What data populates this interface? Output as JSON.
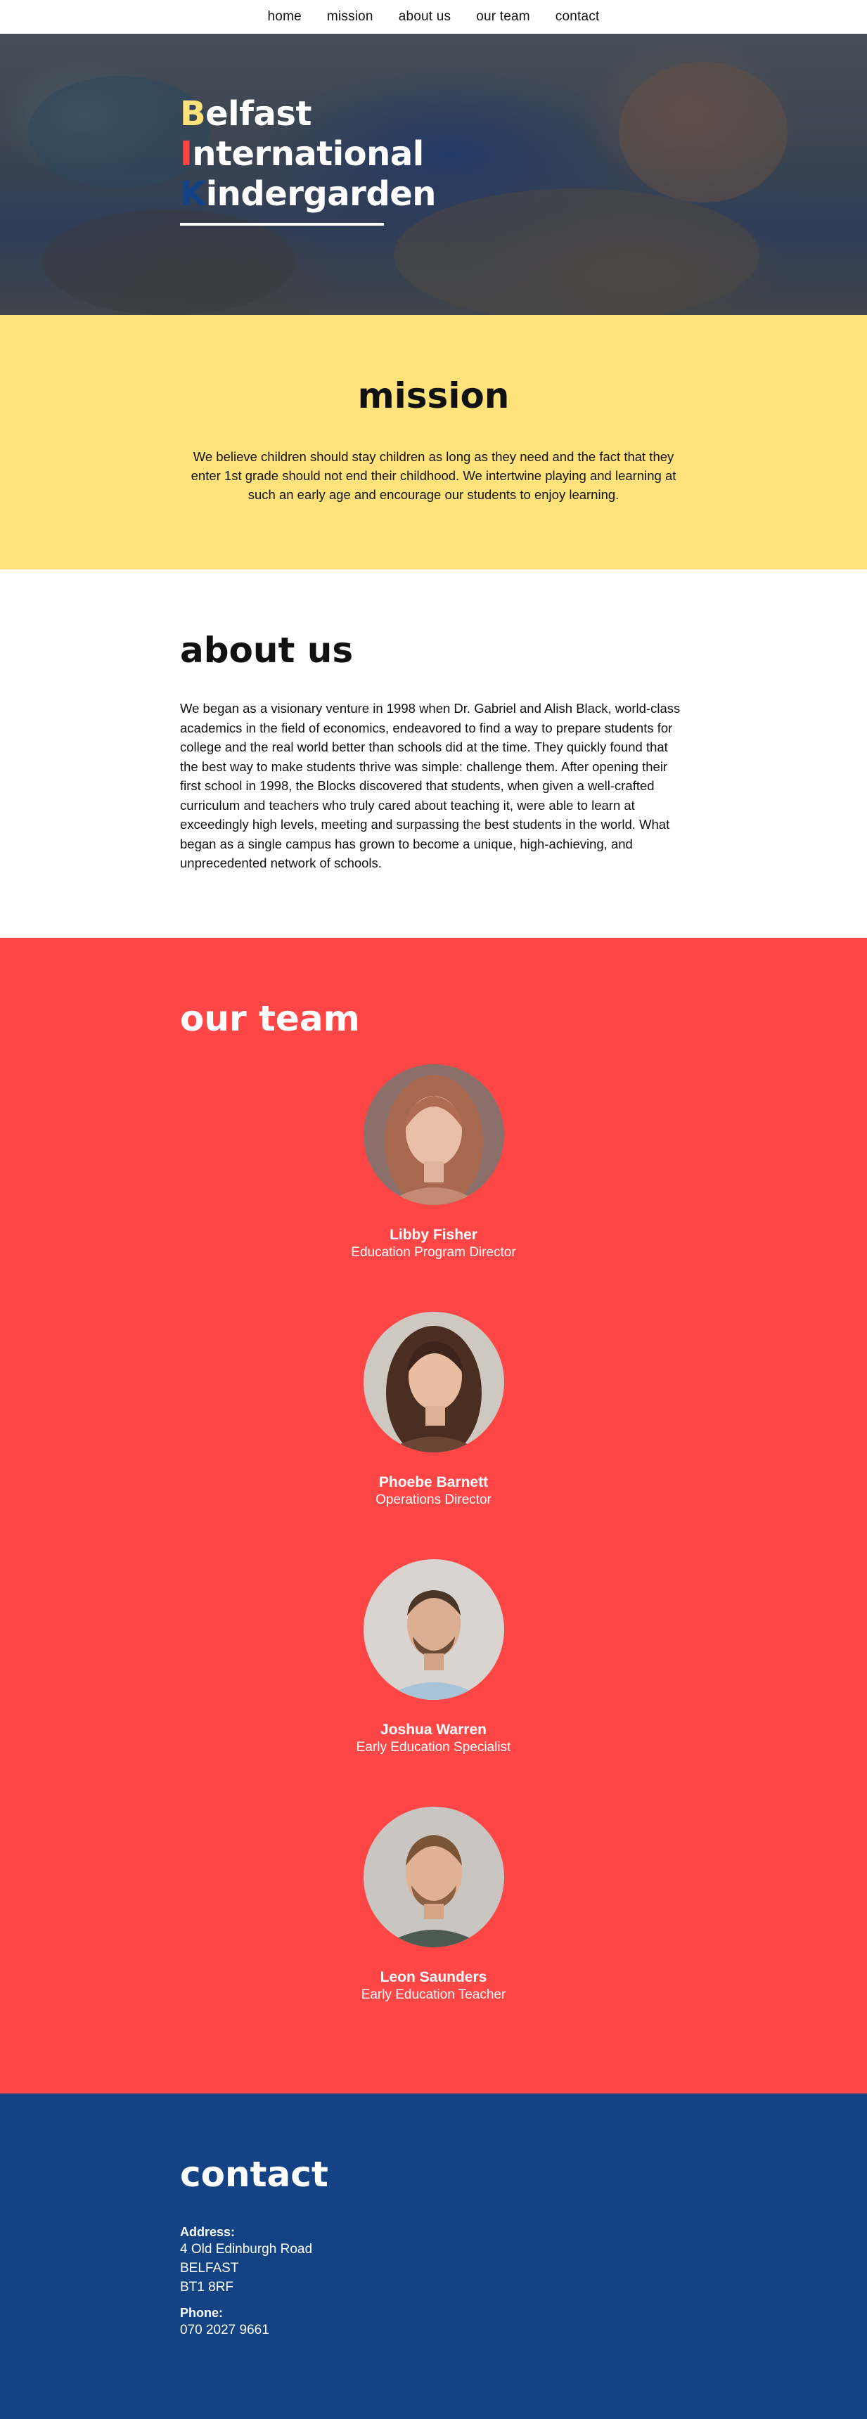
{
  "nav": {
    "items": [
      {
        "label": "home"
      },
      {
        "label": "mission"
      },
      {
        "label": "about us"
      },
      {
        "label": "our team"
      },
      {
        "label": "contact"
      }
    ]
  },
  "hero": {
    "lines": [
      {
        "initial": "B",
        "rest": "elfast",
        "initial_color": "#ffe37a"
      },
      {
        "initial": "I",
        "rest": "nternational",
        "initial_color": "#ff4646"
      },
      {
        "initial": "K",
        "rest": "indergarden",
        "initial_color": "#134384"
      }
    ]
  },
  "mission": {
    "title": "mission",
    "text": "We believe children should stay children as long as they need and the fact that they enter 1st grade should not end their childhood. We intertwine playing and learning at such an early age and encourage our students to enjoy learning."
  },
  "about": {
    "title": "about us",
    "text": "We began as a visionary venture in 1998 when Dr. Gabriel and Alish Black, world-class academics in the field of economics, endeavored to find a way to prepare students for college and the real world better than schools did at the time. They quickly found that the best way to make students thrive was simple: challenge them. After opening their first school in 1998, the Blocks discovered that students, when given a well-crafted curriculum and teachers who truly cared about teaching it, were able to learn at exceedingly high levels, meeting and surpassing the best students in the world. What began as a single campus has grown to become a unique, high-achieving, and unprecedented network of schools."
  },
  "team": {
    "title": "our team",
    "members": [
      {
        "name": "Libby Fisher",
        "role": "Education Program Director"
      },
      {
        "name": "Phoebe Barnett",
        "role": "Operations Director"
      },
      {
        "name": "Joshua Warren",
        "role": "Early Education Specialist"
      },
      {
        "name": "Leon Saunders",
        "role": "Early Education Teacher"
      }
    ]
  },
  "contact": {
    "title": "contact",
    "address_label": "Address:",
    "address_lines": [
      "4 Old Edinburgh Road",
      "BELFAST",
      "BT1 8RF"
    ],
    "phone_label": "Phone:",
    "phone": "070 2027 9661"
  },
  "colors": {
    "yellow": "#ffe37a",
    "red": "#ff4646",
    "blue": "#134384"
  }
}
